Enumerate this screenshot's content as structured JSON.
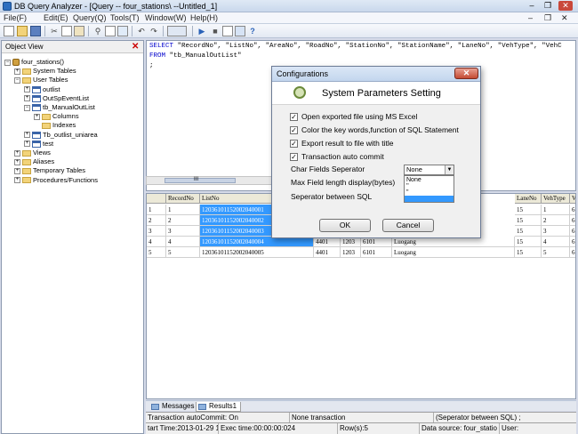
{
  "window": {
    "title": "DB Query Analyzer - [Query -- four_stations\\  --Untitled_1]",
    "minimize": "–",
    "restore": "❐",
    "close": "✕"
  },
  "menu": [
    "File(F)",
    "Edit(E)",
    "Query(Q)",
    "Tools(T)",
    "Window(W)",
    "Help(H)"
  ],
  "inner_window_controls": {
    "minimize": "–",
    "restore": "❐",
    "close": "✕"
  },
  "object_view": {
    "title": "Object View",
    "close": "✕",
    "tree": [
      {
        "label": "four_stations()",
        "expand": "−",
        "icon": "database"
      },
      {
        "label": "System Tables",
        "expand": "+",
        "icon": "folder"
      },
      {
        "label": "User Tables",
        "expand": "−",
        "icon": "folder"
      },
      {
        "label": "outlist",
        "expand": "+",
        "icon": "table"
      },
      {
        "label": "OutSpEventList",
        "expand": "+",
        "icon": "table"
      },
      {
        "label": "tb_ManualOutList",
        "expand": "−",
        "icon": "table"
      },
      {
        "label": "Columns",
        "expand": "+",
        "icon": "folder"
      },
      {
        "label": "Indexes",
        "expand": "",
        "icon": "folder"
      },
      {
        "label": "Tb_outlist_uniarea",
        "expand": "+",
        "icon": "table"
      },
      {
        "label": "test",
        "expand": "+",
        "icon": "table"
      },
      {
        "label": "Views",
        "expand": "+",
        "icon": "folder"
      },
      {
        "label": "Aliases",
        "expand": "+",
        "icon": "folder"
      },
      {
        "label": "Temporary Tables",
        "expand": "+",
        "icon": "folder"
      },
      {
        "label": "Procedures/Functions",
        "expand": "+",
        "icon": "folder"
      }
    ]
  },
  "editor": {
    "line1_kw": "SELECT",
    "line1_rest": "  \"RecordNo\", \"ListNo\", \"AreaNo\", \"RoadNo\", \"StationNo\", \"StationName\", \"LaneNo\", \"VehType\", \"VehC",
    "line2_kw": "FROM",
    "line2_rest": "  \"tb_ManualOutList\"",
    "line3": ";",
    "hscroll": "III"
  },
  "grid": {
    "headers": [
      "",
      "RecordNo",
      "ListNo",
      "",
      "",
      "",
      "LaneNo",
      "VehType",
      "V"
    ],
    "rows": [
      [
        "1",
        "1",
        "12036101152002040001",
        "",
        "",
        "",
        "15",
        "1",
        "6"
      ],
      [
        "2",
        "2",
        "12036101152002040002",
        "",
        "",
        "",
        "15",
        "2",
        "6"
      ],
      [
        "3",
        "3",
        "12036101152002040003",
        "",
        "",
        "",
        "15",
        "3",
        "6"
      ],
      [
        "4",
        "4",
        "12036101152002040004",
        "4401",
        "1203",
        "6101",
        "Luogang",
        "15",
        "4",
        "6"
      ],
      [
        "5",
        "5",
        "12036101152002040005",
        "4401",
        "1203",
        "6101",
        "Luogang",
        "15",
        "5",
        "6"
      ]
    ]
  },
  "tabs": [
    "Messages",
    "Results1"
  ],
  "status": {
    "row1": [
      "Transaction autoCommit: On",
      "None transaction",
      "(Seperator between SQL)  ;"
    ],
    "row2": [
      "tart Time:2013-01-29 16:39:2",
      "Exec time:00:00:00:024",
      "Row(s):5",
      "Data source: four_statio",
      "User:"
    ]
  },
  "dialog": {
    "title": "Configurations",
    "close": "✕",
    "heading": "System Parameters Setting",
    "checkboxes": [
      {
        "label": "Open exported file using MS Excel",
        "checked": true
      },
      {
        "label": "Color the key words,function of SQL Statement",
        "checked": true
      },
      {
        "label": "Export result to file with title",
        "checked": true
      },
      {
        "label": "Transaction auto commit",
        "checked": true
      }
    ],
    "char_sep_label": "Char Fields Seperator",
    "char_sep_value": "None",
    "char_sep_options": [
      "None",
      "''",
      "\"",
      ""
    ],
    "char_sep_highlight": 3,
    "maxlen_label": "Max Field length display(bytes)",
    "sql_sep_label": "Seperator between SQL",
    "ok": "OK",
    "cancel": "Cancel",
    "check_mark": "✓",
    "arrow": "▼"
  }
}
